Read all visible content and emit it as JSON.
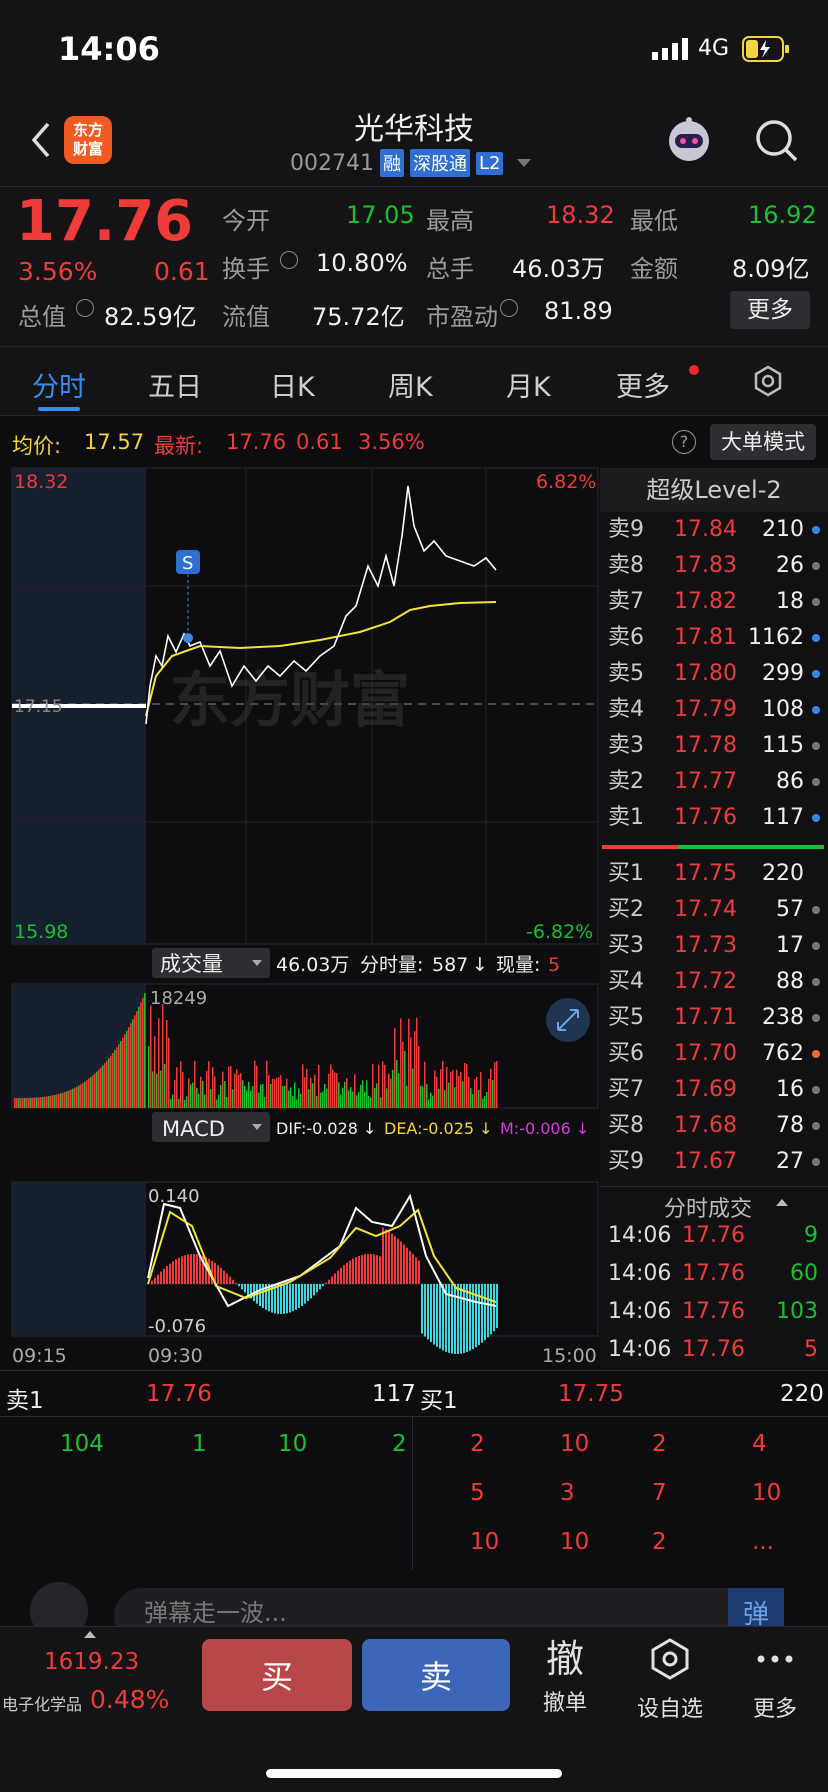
{
  "status": {
    "time": "14:06",
    "network": "4G"
  },
  "header": {
    "logo_text": "东方\n财富",
    "name": "光华科技",
    "code": "002741",
    "tags": [
      "融",
      "深股通",
      "L2"
    ]
  },
  "quote": {
    "price": "17.76",
    "pct": "3.56%",
    "chg": "0.61",
    "fields": [
      {
        "label": "今开",
        "value": "17.05"
      },
      {
        "label": "最高",
        "value": "18.32"
      },
      {
        "label": "最低",
        "value": "16.92"
      },
      {
        "label": "换手",
        "value": "10.80%"
      },
      {
        "label": "总手",
        "value": "46.03万"
      },
      {
        "label": "金额",
        "value": "8.09亿"
      },
      {
        "label": "总值",
        "value": "82.59亿"
      },
      {
        "label": "流值",
        "value": "75.72亿"
      },
      {
        "label": "市盈动",
        "value": "81.89"
      }
    ],
    "more": "更多"
  },
  "tabs": [
    "分时",
    "五日",
    "日K",
    "周K",
    "月K",
    "更多"
  ],
  "infobar": {
    "avg_label": "均价:",
    "avg_value": "17.57",
    "latest_label": "最新:",
    "latest_value": "17.76",
    "chg": "0.61",
    "pct": "3.56%",
    "mode_btn": "大单模式"
  },
  "chart": {
    "y_top": "18.32",
    "y_mid": "17.15",
    "y_bottom": "15.98",
    "pct_top": "6.82%",
    "pct_bottom": "-6.82%",
    "watermark": "东方财富",
    "signal": "S"
  },
  "volume": {
    "selector": "成交量",
    "total": "46.03万",
    "min_label": "分时量:",
    "min_value": "587",
    "now_label": "现量:",
    "now_value": "5",
    "peak": "18249"
  },
  "macd": {
    "selector": "MACD",
    "dif": "DIF:-0.028 ↓",
    "dea": "DEA:-0.025 ↓",
    "m": "M:-0.006 ↓",
    "top": "0.140",
    "bottom": "-0.076"
  },
  "time_axis": [
    "09:15",
    "09:30",
    "15:00"
  ],
  "level2": {
    "title": "超级Level-2",
    "asks": [
      {
        "label": "卖9",
        "price": "17.84",
        "vol": "210",
        "dot": "#3a86e8"
      },
      {
        "label": "卖8",
        "price": "17.83",
        "vol": "26",
        "dot": "#777"
      },
      {
        "label": "卖7",
        "price": "17.82",
        "vol": "18",
        "dot": "#777"
      },
      {
        "label": "卖6",
        "price": "17.81",
        "vol": "1162",
        "dot": "#3a86e8"
      },
      {
        "label": "卖5",
        "price": "17.80",
        "vol": "299",
        "dot": "#3a86e8"
      },
      {
        "label": "卖4",
        "price": "17.79",
        "vol": "108",
        "dot": "#3a86e8"
      },
      {
        "label": "卖3",
        "price": "17.78",
        "vol": "115",
        "dot": "#777"
      },
      {
        "label": "卖2",
        "price": "17.77",
        "vol": "86",
        "dot": "#777"
      },
      {
        "label": "卖1",
        "price": "17.76",
        "vol": "117",
        "dot": "#3a86e8"
      }
    ],
    "bids": [
      {
        "label": "买1",
        "price": "17.75",
        "vol": "220",
        "dot": ""
      },
      {
        "label": "买2",
        "price": "17.74",
        "vol": "57",
        "dot": "#777"
      },
      {
        "label": "买3",
        "price": "17.73",
        "vol": "17",
        "dot": "#777"
      },
      {
        "label": "买4",
        "price": "17.72",
        "vol": "88",
        "dot": "#777"
      },
      {
        "label": "买5",
        "price": "17.71",
        "vol": "238",
        "dot": "#777"
      },
      {
        "label": "买6",
        "price": "17.70",
        "vol": "762",
        "dot": "#f06a2a"
      },
      {
        "label": "买7",
        "price": "17.69",
        "vol": "16",
        "dot": "#777"
      },
      {
        "label": "买8",
        "price": "17.68",
        "vol": "78",
        "dot": "#777"
      },
      {
        "label": "买9",
        "price": "17.67",
        "vol": "27",
        "dot": "#777"
      }
    ],
    "ticks_title": "分时成交",
    "ticks": [
      {
        "time": "14:06",
        "price": "17.76",
        "vol": "9",
        "color": "#19c02f"
      },
      {
        "time": "14:06",
        "price": "17.76",
        "vol": "60",
        "color": "#19c02f"
      },
      {
        "time": "14:06",
        "price": "17.76",
        "vol": "103",
        "color": "#19c02f"
      },
      {
        "time": "14:06",
        "price": "17.76",
        "vol": "5",
        "color": "#f03b3b"
      }
    ]
  },
  "queue": {
    "sell_label": "卖1",
    "sell_price": "17.76",
    "sell_vol": "117",
    "buy_label": "买1",
    "buy_price": "17.75",
    "buy_vol": "220",
    "sell_orders": [
      "104",
      "1",
      "10",
      "2"
    ],
    "buy_orders": [
      "2",
      "10",
      "2",
      "4",
      "5",
      "3",
      "7",
      "10",
      "10",
      "10",
      "2",
      "..."
    ]
  },
  "comment": {
    "placeholder": "弹幕走一波...",
    "send": "弹"
  },
  "bottom": {
    "index_value": "1619.23",
    "index_name": "电子化学品",
    "index_pct": "0.48%",
    "buy": "买",
    "sell": "卖",
    "cancel_icon": "撤",
    "cancel": "撤单",
    "watch": "设自选",
    "more": "更多"
  }
}
